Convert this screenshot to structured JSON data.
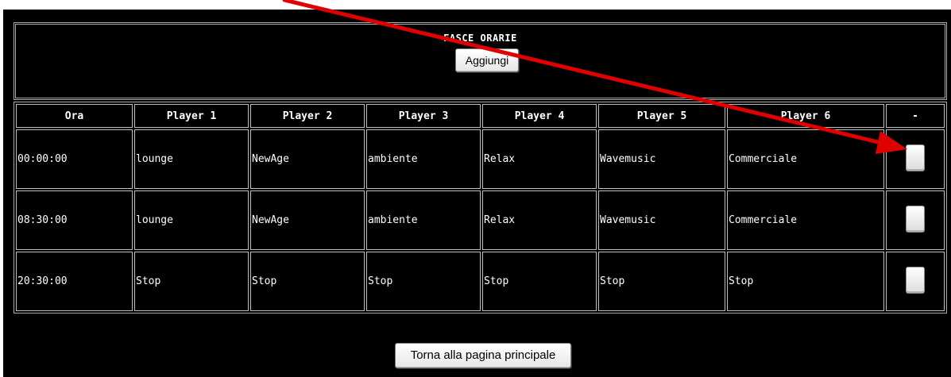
{
  "header": {
    "title": "FASCE ORARIE",
    "add_label": "Aggiungi"
  },
  "columns": [
    "Ora",
    "Player 1",
    "Player 2",
    "Player 3",
    "Player 4",
    "Player 5",
    "Player 6",
    "-"
  ],
  "rows": [
    {
      "ora": "00:00:00",
      "p1": "lounge",
      "p2": "NewAge",
      "p3": "ambiente",
      "p4": "Relax",
      "p5": "Wavemusic",
      "p6": "Commerciale"
    },
    {
      "ora": "08:30:00",
      "p1": "lounge",
      "p2": "NewAge",
      "p3": "ambiente",
      "p4": "Relax",
      "p5": "Wavemusic",
      "p6": "Commerciale"
    },
    {
      "ora": "20:30:00",
      "p1": "Stop",
      "p2": "Stop",
      "p3": "Stop",
      "p4": "Stop",
      "p5": "Stop",
      "p6": "Stop"
    }
  ],
  "footer": {
    "home_label": "Torna alla pagina principale"
  },
  "colors": {
    "background": "#000000",
    "text": "#ffffff",
    "border": "#bfbfbf",
    "annotation_arrow": "#e00000"
  }
}
